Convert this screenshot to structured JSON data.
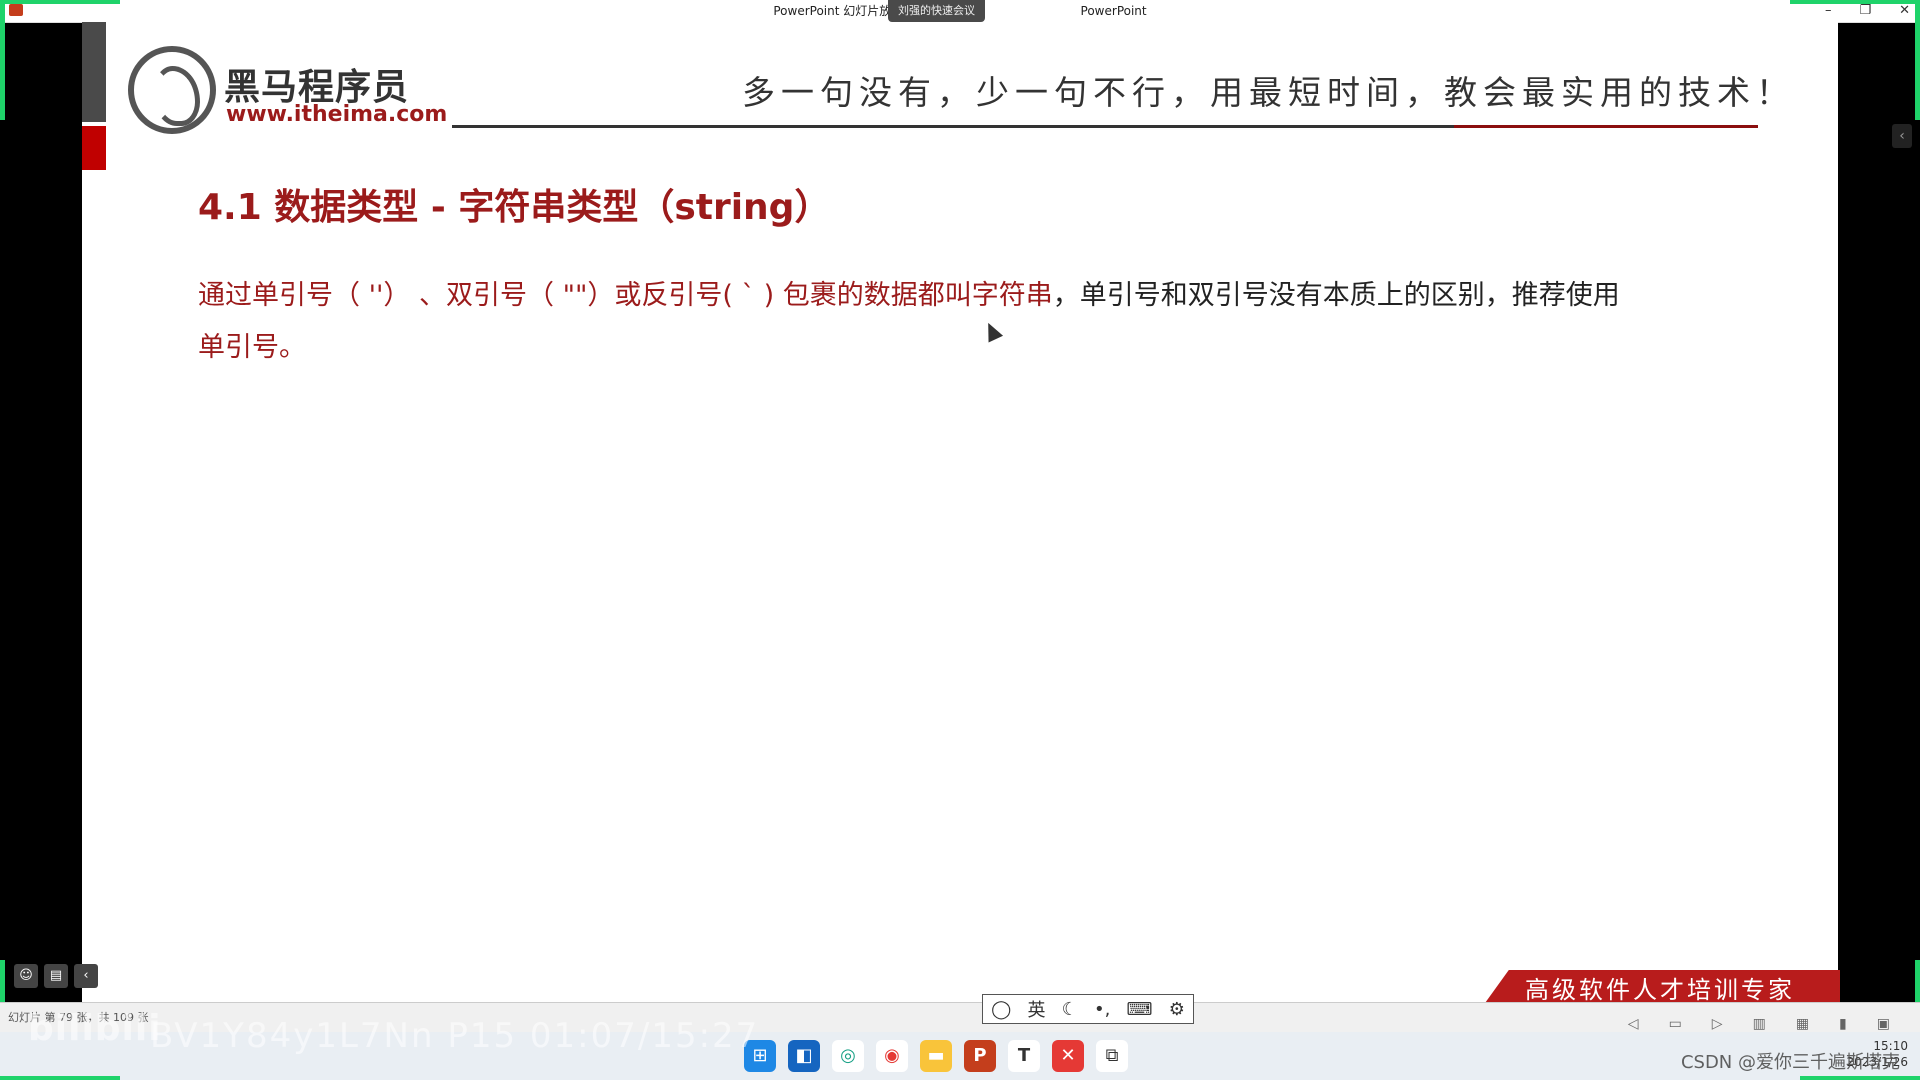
{
  "window": {
    "title_left": "PowerPoint 幻灯片放映 - [JavaS",
    "title_right": "PowerPoint",
    "meeting_label": "刘强的快速会议",
    "controls": [
      "–",
      "❐",
      "✕"
    ]
  },
  "slide": {
    "logo_cn": "黑马程序员",
    "logo_url": "www.itheima.com",
    "slogan": "多一句没有，少一句不行，用最短时间，教会最实用的技术！",
    "title": "4.1 数据类型 - 字符串类型（string）",
    "body_red": "通过单引号（ ''） 、双引号（ \"\"）或反引号( ` ) 包裹的数据都叫字符串",
    "body_dark": "，单引号和双引号没有本质上的区别，推荐使用",
    "body_red2": "单引号。",
    "banner": "高级软件人才培训专家"
  },
  "status": {
    "slide_count": "幻灯片 第 79 张，共 109 张"
  },
  "ime": {
    "items": [
      "◯",
      "英",
      "☾",
      "•,",
      "⌨",
      "⚙"
    ]
  },
  "overlay": {
    "bilibili": "bilibili",
    "bv": "BV1Y84y1L7Nn P15 01:07/15:27",
    "csdn": "CSDN @爱你三千遍斯塔克"
  },
  "taskbar": {
    "icons": [
      "start-icon",
      "widgets-icon",
      "app-icon",
      "chrome-icon",
      "files-icon",
      "powerpoint-icon",
      "typora-icon",
      "xmind-icon",
      "remote-icon"
    ],
    "clock_time": "15:10",
    "clock_date": "2023/1/26"
  },
  "colors": {
    "accent_red": "#9b1b1b",
    "green_frame": "#1fd36a"
  }
}
